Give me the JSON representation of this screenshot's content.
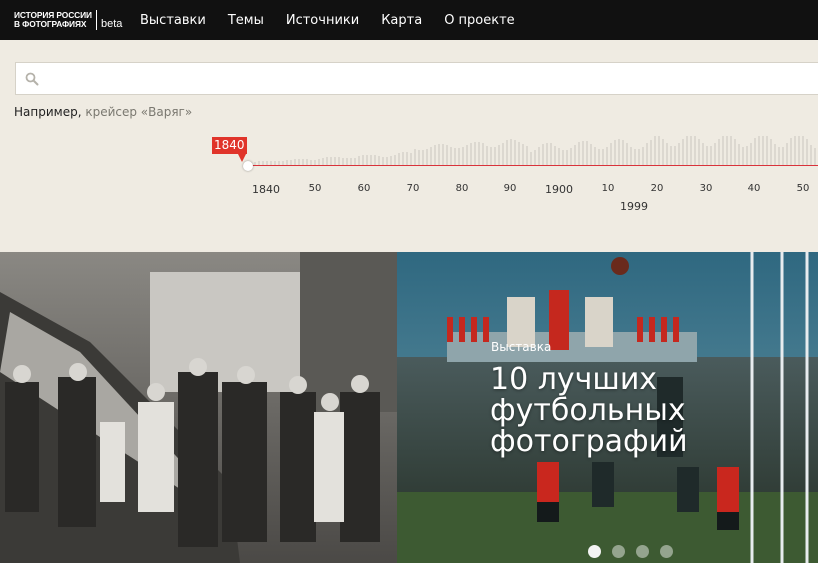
{
  "header": {
    "logo_line1": "ИСТОРИЯ РОССИИ",
    "logo_line2": "В ФОТОГРАФИЯХ",
    "logo_beta": "beta",
    "nav": [
      "Выставки",
      "Темы",
      "Источники",
      "Карта",
      "О проекте"
    ]
  },
  "search": {
    "value": "",
    "placeholder": "",
    "example_prefix": "Например, ",
    "example_link": "крейсер «Варяг»"
  },
  "timeline": {
    "selected_start": "1840",
    "selected_end": "1999",
    "ticks": [
      "1840",
      "50",
      "60",
      "70",
      "80",
      "90",
      "1900",
      "10",
      "20",
      "30",
      "40",
      "50"
    ]
  },
  "featured": {
    "label": "Выставка",
    "title": "10 лучших футбольных фотографий",
    "slides": 4,
    "active_slide": 1
  },
  "colors": {
    "accent": "#e0342a",
    "header_bg": "#111111",
    "page_bg": "#efebe2"
  },
  "icons": {
    "search": "search-icon"
  }
}
